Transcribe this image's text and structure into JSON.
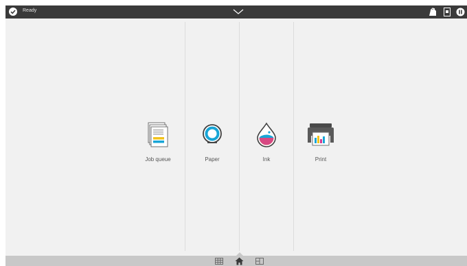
{
  "status": {
    "text": "Ready",
    "icon": "check-circle-icon"
  },
  "topbar": {
    "expand_icon": "chevron-down-icon",
    "right_icons": [
      "toner-icon",
      "document-icon",
      "pause-icon"
    ]
  },
  "tiles": [
    {
      "label": "Job queue",
      "icon": "job-queue-icon"
    },
    {
      "label": "Paper",
      "icon": "paper-roll-icon"
    },
    {
      "label": "Ink",
      "icon": "ink-drop-icon"
    },
    {
      "label": "Print",
      "icon": "printer-icon"
    }
  ],
  "bottombar": {
    "icons": [
      "grid-view-icon",
      "home-icon",
      "split-view-icon"
    ],
    "active": "home-icon"
  },
  "colors": {
    "topbar": "#3a3a3a",
    "background": "#f1f1f1",
    "bottombar": "#c8c8c8",
    "accent_cyan": "#18a5d6",
    "ink_magenta": "#d43c8f",
    "ink_yellow": "#f2c31c"
  }
}
